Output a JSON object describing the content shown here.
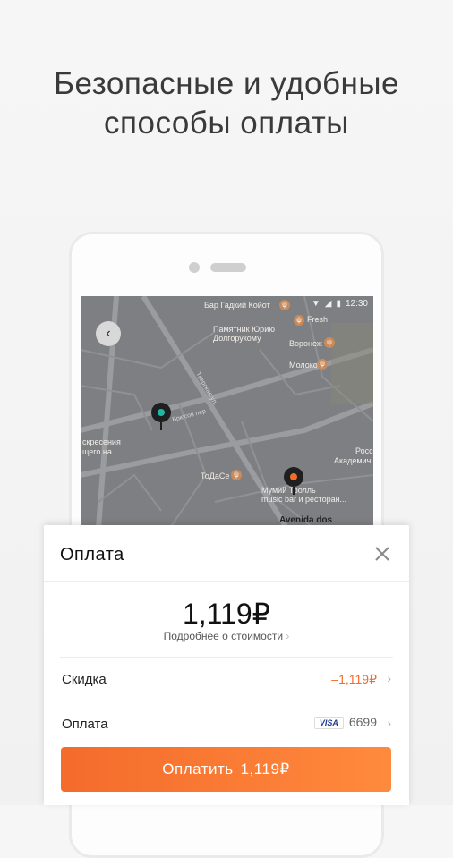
{
  "headline": {
    "line1": "Безопасные и удобные",
    "line2": "способы оплаты"
  },
  "map": {
    "status_time": "12:30",
    "labels": [
      "Бар Гадкий Койот",
      "Fresh",
      "Памятник Юрию",
      "Долгорукому",
      "Воронеж",
      "Молоко",
      "Тверская ул.",
      "ТоДаСе",
      "Мумий Тролль",
      "music bar и ресторан...",
      "Avenida dos",
      "Росс",
      "Академич",
      "скресения",
      "щего на...",
      "Брюсов пер."
    ]
  },
  "sheet": {
    "title": "Оплата",
    "price": "1,119₽",
    "price_details": "Подробнее о стоимости",
    "discount_label": "Скидка",
    "discount_value": "–1,119₽",
    "payment_label": "Оплата",
    "card_brand": "VISA",
    "card_last4": "6699",
    "pay_button_label": "Оплатить",
    "pay_button_amount": "1,119₽",
    "colors": {
      "accent": "#f46b2b",
      "discount": "#f46b2b"
    }
  }
}
